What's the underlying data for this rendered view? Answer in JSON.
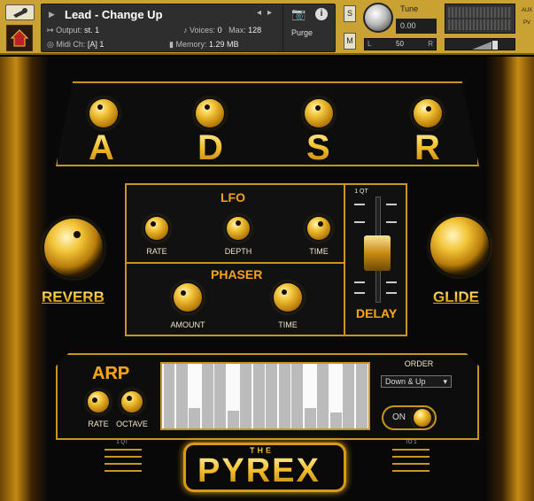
{
  "header": {
    "title": "Lead - Change Up",
    "output_label": "Output:",
    "output_value": "st. 1",
    "voices_label": "Voices:",
    "voices_value": "0",
    "max_label": "Max:",
    "max_value": "128",
    "purge_label": "Purge",
    "midi_label": "Midi Ch:",
    "midi_value": "[A]  1",
    "memory_label": "Memory:",
    "memory_value": "1.29 MB",
    "solo_label": "S",
    "mute_label": "M",
    "tune_label": "Tune",
    "tune_value": "0.00",
    "pan_left": "L",
    "pan_center": "50",
    "pan_right": "R",
    "aux_label": "AUX",
    "pv_label": "PV"
  },
  "adsr": {
    "letters": [
      "A",
      "D",
      "S",
      "R"
    ]
  },
  "lfo": {
    "title": "LFO",
    "knobs": [
      "RATE",
      "DEPTH",
      "TIME"
    ]
  },
  "phaser": {
    "title": "PHASER",
    "knobs": [
      "AMOUNT",
      "TIME"
    ]
  },
  "delay": {
    "title": "DELAY",
    "time_label": "1 QT"
  },
  "reverb_label": "REVERB",
  "glide_label": "GLIDE",
  "arp": {
    "title": "ARP",
    "knobs": [
      "RATE",
      "OCTAVE"
    ],
    "order_label": "ORDER",
    "order_value": "Down & Up",
    "on_label": "ON",
    "steps": [
      1.0,
      1.0,
      0.32,
      1.0,
      1.0,
      0.28,
      1.0,
      1.0,
      1.0,
      1.0,
      1.0,
      0.32,
      1.0,
      0.25,
      1.0,
      1.0
    ],
    "left_rate_label": "1 QT",
    "right_rate_label": "TO 1"
  },
  "brand": {
    "the": "THE",
    "name": "PYREX"
  }
}
